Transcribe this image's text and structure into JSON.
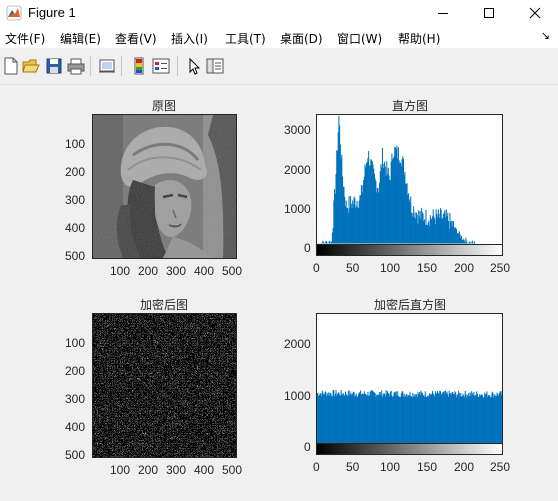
{
  "window": {
    "title": "Figure 1",
    "icons": [
      "matlab-icon",
      "minimize-icon",
      "maximize-icon",
      "close-icon"
    ]
  },
  "menu": {
    "items": [
      "文件(F)",
      "编辑(E)",
      "查看(V)",
      "插入(I)",
      "工具(T)",
      "桌面(D)",
      "窗口(W)",
      "帮助(H)"
    ],
    "overflow": "↘"
  },
  "toolbar": {
    "icons": [
      "new-figure-icon",
      "open-file-icon",
      "save-icon",
      "print-icon",
      "link-figure-icon",
      "insert-colorbar-icon",
      "insert-legend-icon",
      "edit-plot-icon",
      "property-inspector-icon"
    ]
  },
  "plots": {
    "original": {
      "title": "原图",
      "x_ticks": [
        "100",
        "200",
        "300",
        "400",
        "500"
      ],
      "y_ticks": [
        "100",
        "200",
        "300",
        "400",
        "500"
      ]
    },
    "original_hist": {
      "title": "直方图",
      "x_ticks": [
        "0",
        "50",
        "100",
        "150",
        "200",
        "250"
      ],
      "y_ticks": [
        "0",
        "1000",
        "2000",
        "3000"
      ]
    },
    "encrypted": {
      "title": "加密后图",
      "x_ticks": [
        "100",
        "200",
        "300",
        "400",
        "500"
      ],
      "y_ticks": [
        "100",
        "200",
        "300",
        "400",
        "500"
      ]
    },
    "encrypted_hist": {
      "title": "加密后直方图",
      "x_ticks": [
        "0",
        "50",
        "100",
        "150",
        "200",
        "250"
      ],
      "y_ticks": [
        "0",
        "1000",
        "2000"
      ]
    }
  },
  "chart_data": [
    {
      "type": "bar",
      "title": "直方图",
      "color": "#0072bd",
      "xlim": [
        0,
        255
      ],
      "ylim": [
        -250,
        3400
      ],
      "x": [
        0,
        20,
        25,
        30,
        35,
        40,
        50,
        60,
        70,
        80,
        85,
        90,
        100,
        105,
        110,
        115,
        120,
        130,
        140,
        150,
        160,
        170,
        180,
        190,
        200,
        210,
        220,
        255
      ],
      "values": [
        0,
        50,
        1500,
        3350,
        1800,
        1000,
        1100,
        1200,
        2400,
        1650,
        1500,
        2300,
        1700,
        2500,
        2400,
        2350,
        2000,
        1000,
        750,
        700,
        700,
        700,
        650,
        400,
        150,
        20,
        0,
        0
      ]
    },
    {
      "type": "bar",
      "title": "加密后直方图",
      "color": "#0072bd",
      "xlim": [
        0,
        255
      ],
      "ylim": [
        -150,
        2600
      ],
      "x": [
        0,
        255
      ],
      "values": [
        1020,
        1000
      ]
    }
  ]
}
